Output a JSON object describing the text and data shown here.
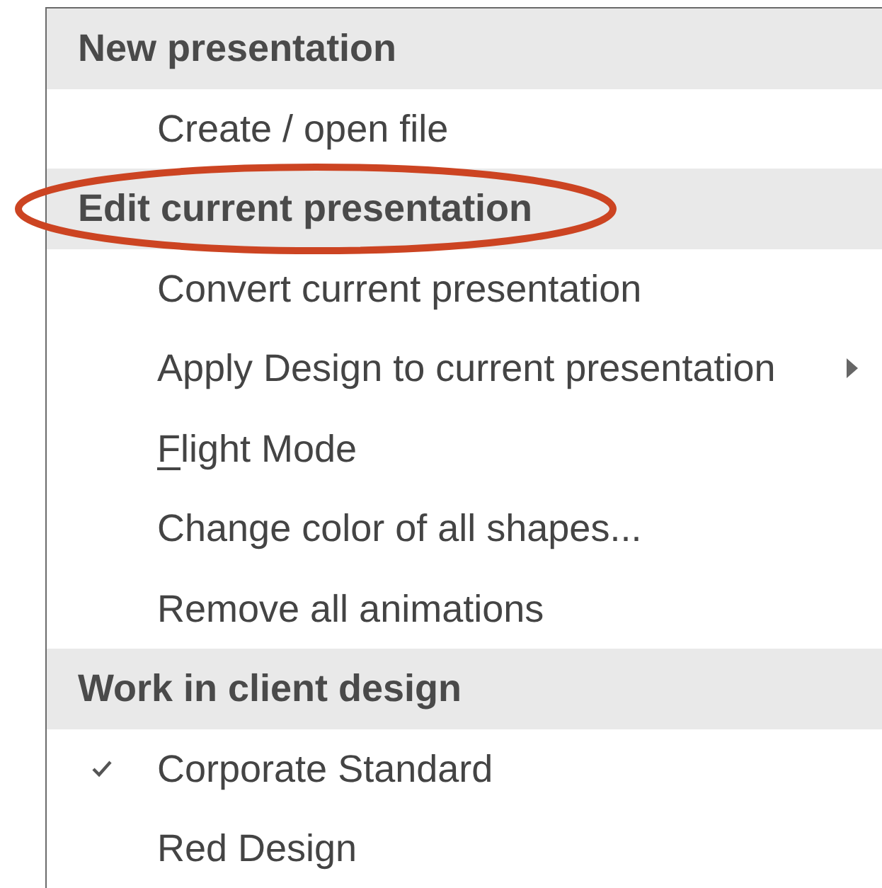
{
  "sections": [
    {
      "header": {
        "label": "New presentation",
        "highlighted": false
      },
      "items": [
        {
          "label": "Create / open file",
          "checked": false,
          "submenu": false,
          "access_key_first": false
        }
      ]
    },
    {
      "header": {
        "label": "Edit current presentation",
        "highlighted": true
      },
      "items": [
        {
          "label": "Convert current presentation",
          "checked": false,
          "submenu": false,
          "access_key_first": false
        },
        {
          "label": "Apply Design to current presentation",
          "checked": false,
          "submenu": true,
          "access_key_first": false
        },
        {
          "label": "Flight Mode",
          "checked": false,
          "submenu": false,
          "access_key_first": true
        },
        {
          "label": "Change color of all shapes...",
          "checked": false,
          "submenu": false,
          "access_key_first": false
        },
        {
          "label": "Remove all animations",
          "checked": false,
          "submenu": false,
          "access_key_first": false
        }
      ]
    },
    {
      "header": {
        "label": "Work in client design",
        "highlighted": false
      },
      "items": [
        {
          "label": "Corporate Standard",
          "checked": true,
          "submenu": false,
          "access_key_first": false
        },
        {
          "label": "Red Design",
          "checked": false,
          "submenu": false,
          "access_key_first": false
        }
      ]
    }
  ]
}
